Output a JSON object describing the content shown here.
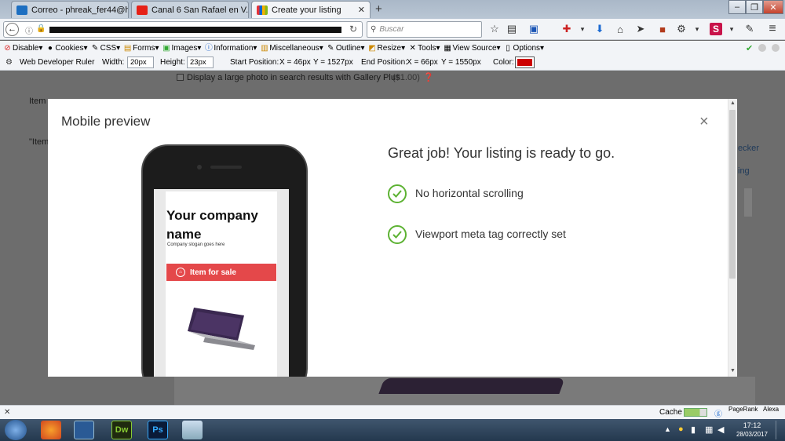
{
  "tabs": [
    {
      "label": "Correo - phreak_fer44@hot...",
      "icon": "outlook-icon"
    },
    {
      "label": "Canal 6 San Rafael en V...",
      "icon": "youtube-icon"
    },
    {
      "label": "Create your listing",
      "icon": "ebay-icon"
    }
  ],
  "search": {
    "placeholder": "Buscar"
  },
  "webdev": {
    "items": [
      "Disable",
      "Cookies",
      "CSS",
      "Forms",
      "Images",
      "Information",
      "Miscellaneous",
      "Outline",
      "Resize",
      "Tools",
      "View Source",
      "Options"
    ]
  },
  "ruler": {
    "title": "Web Developer Ruler",
    "width_label": "Width:",
    "width_value": "20px",
    "height_label": "Height:",
    "height_value": "23px",
    "start_label": "Start Position:",
    "start_x": "X = 46px",
    "start_y": "Y = 1527px",
    "end_label": "End Position:",
    "end_x": "X = 66px",
    "end_y": "Y = 1550px",
    "color_label": "Color:",
    "color_value": "#cc0000"
  },
  "page": {
    "gallery_text": "Display a large photo in search results with Gallery Plus",
    "gallery_price": "($1.00)",
    "item_label": "Item",
    "item_label2": "\"Item",
    "checker": "ecker",
    "ing": "ing"
  },
  "modal": {
    "title": "Mobile preview",
    "close": "×",
    "company_name": "Your company name",
    "slogan": "Company slogan goes here",
    "ribbon": "Item for sale",
    "headline": "Great job! Your listing is ready to go.",
    "checks": [
      "No horizontal scrolling",
      "Viewport meta tag correctly set"
    ]
  },
  "status": {
    "cache": "Cache",
    "pagerank": "PageRank",
    "alexa": "Alexa"
  },
  "taskbar": {
    "time": "17:12",
    "date": "28/03/2017",
    "apps": [
      "Dw",
      "Ps"
    ]
  },
  "colors": {
    "check_green": "#5db233",
    "ribbon_red": "#e4484a"
  }
}
